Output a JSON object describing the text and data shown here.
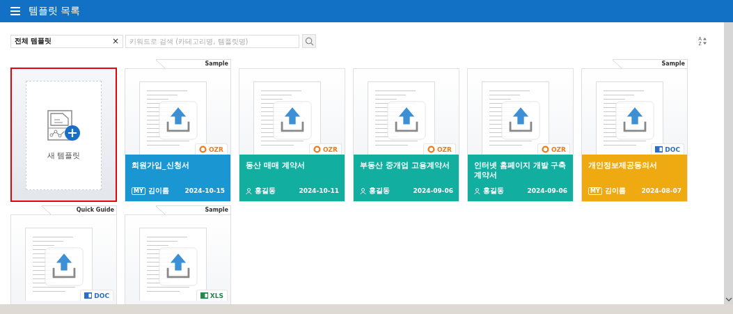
{
  "header": {
    "title": "템플릿 목록"
  },
  "toolbar": {
    "filter": {
      "value": "전체 템플릿",
      "clear": "×"
    },
    "search": {
      "placeholder": "키워드로 검색 (카테고리명, 템플릿명)"
    },
    "sort": {
      "top": "A",
      "bottom": "Z"
    }
  },
  "new_template": {
    "label": "새 템플릿",
    "selected": true
  },
  "cards": [
    {
      "tag": "Sample",
      "title": "회원가입_신청서",
      "owner": {
        "badge": "MY",
        "name": "김이름"
      },
      "date": "2024-10-15",
      "format": "OZR",
      "kind": "ozr",
      "color": "#1a96d2"
    },
    {
      "title": "동산 매매 계약서",
      "owner": {
        "name": "홍길동"
      },
      "date": "2024-10-11",
      "format": "OZR",
      "kind": "ozr",
      "color": "#12aea0"
    },
    {
      "title": "부동산 중개업 고용계약서",
      "owner": {
        "name": "홍길동"
      },
      "date": "2024-09-06",
      "format": "OZR",
      "kind": "ozr",
      "color": "#12aea0"
    },
    {
      "title": "인터넷 홈페이지 개발 구축 계약서",
      "owner": {
        "name": "홍길동"
      },
      "date": "2024-09-06",
      "format": "OZR",
      "kind": "ozr",
      "color": "#12aea0"
    },
    {
      "tag": "Sample",
      "title": "개인정보제공동의서",
      "owner": {
        "badge": "MY",
        "name": "김이름"
      },
      "date": "2024-08-07",
      "format": "DOC",
      "kind": "doc",
      "color": "#eeaa10"
    },
    {
      "tag": "Quick Guide",
      "format": "DOC",
      "kind": "doc"
    },
    {
      "tag": "Sample",
      "format": "XLS",
      "kind": "xls"
    }
  ]
}
